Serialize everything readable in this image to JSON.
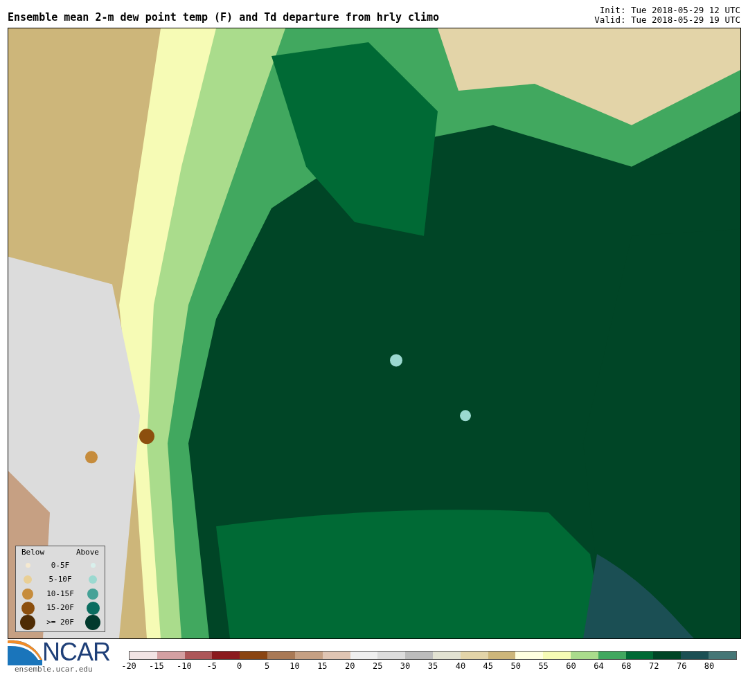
{
  "header": {
    "title": "Ensemble mean 2-m dew point temp (F) and Td departure from hrly climo",
    "init": "Init: Tue 2018-05-29 12 UTC",
    "valid": "Valid: Tue 2018-05-29 19 UTC"
  },
  "legend": {
    "below_label": "Below",
    "above_label": "Above",
    "rows": [
      {
        "label": "0-5F",
        "dots": [
          {
            "color": "#f5e9d0"
          },
          {
            "color": "#d9f0ec"
          }
        ]
      },
      {
        "label": "5-10F",
        "dots": [
          {
            "color": "#e9cf95"
          },
          {
            "color": "#9bd9d0"
          }
        ]
      },
      {
        "label": "10-15F",
        "dots": [
          {
            "color": "#c68c3c"
          },
          {
            "color": "#45a297"
          }
        ]
      },
      {
        "label": "15-20F",
        "dots": [
          {
            "color": "#8c4f0e"
          },
          {
            "color": "#0b6d60"
          }
        ]
      },
      {
        "label": ">= 20F",
        "dots": [
          {
            "color": "#4f2c04"
          },
          {
            "color": "#013a2d"
          }
        ]
      }
    ]
  },
  "logo": {
    "name": "NCAR",
    "url": "ensemble.ucar.edu"
  },
  "colorbar": {
    "segments": [
      {
        "color": "#f2e4e4"
      },
      {
        "color": "#d4a0a2"
      },
      {
        "color": "#ad5658"
      },
      {
        "color": "#8b1a1e"
      },
      {
        "color": "#8a4512"
      },
      {
        "color": "#a97955"
      },
      {
        "color": "#c6a083"
      },
      {
        "color": "#e0c5b3"
      },
      {
        "color": "#efefef"
      },
      {
        "color": "#dcdcdc"
      },
      {
        "color": "#bcbcbc"
      },
      {
        "color": "#e2e2d2"
      },
      {
        "color": "#e3d4a8"
      },
      {
        "color": "#cdb67a"
      },
      {
        "color": "#ffffe0"
      },
      {
        "color": "#f6fbb5"
      },
      {
        "color": "#aadc8c"
      },
      {
        "color": "#41a85f"
      },
      {
        "color": "#006a35"
      },
      {
        "color": "#004526"
      },
      {
        "color": "#1b4f54"
      },
      {
        "color": "#457676"
      }
    ],
    "ticks": [
      "-20",
      "-15",
      "-10",
      "-5",
      "0",
      "5",
      "10",
      "15",
      "20",
      "25",
      "30",
      "35",
      "40",
      "45",
      "50",
      "55",
      "60",
      "64",
      "68",
      "72",
      "76",
      "80"
    ]
  }
}
